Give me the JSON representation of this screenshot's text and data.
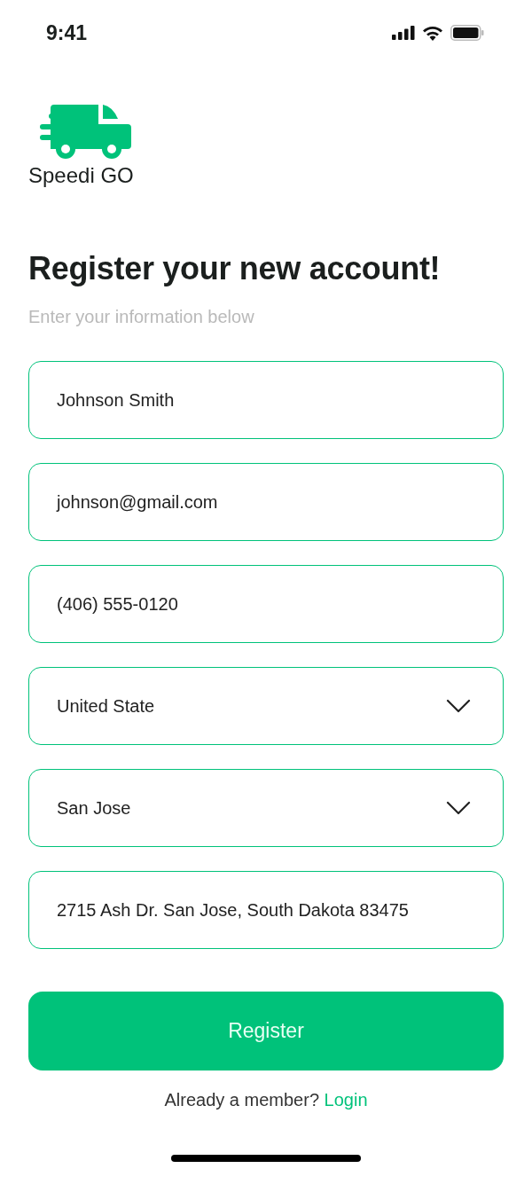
{
  "status_bar": {
    "time": "9:41"
  },
  "brand": {
    "name": "Speedi GO"
  },
  "heading": "Register your new account!",
  "subtitle": "Enter your information below",
  "fields": [
    {
      "kind": "text",
      "value": "Johnson Smith"
    },
    {
      "kind": "text",
      "value": "johnson@gmail.com"
    },
    {
      "kind": "text",
      "value": "(406) 555-0120"
    },
    {
      "kind": "select",
      "value": "United State"
    },
    {
      "kind": "select",
      "value": "San Jose"
    },
    {
      "kind": "text",
      "value": "2715 Ash Dr. San Jose, South Dakota 83475"
    }
  ],
  "submit": {
    "label": "Register"
  },
  "footer": {
    "prompt": "Already a member?",
    "link": "Login"
  }
}
